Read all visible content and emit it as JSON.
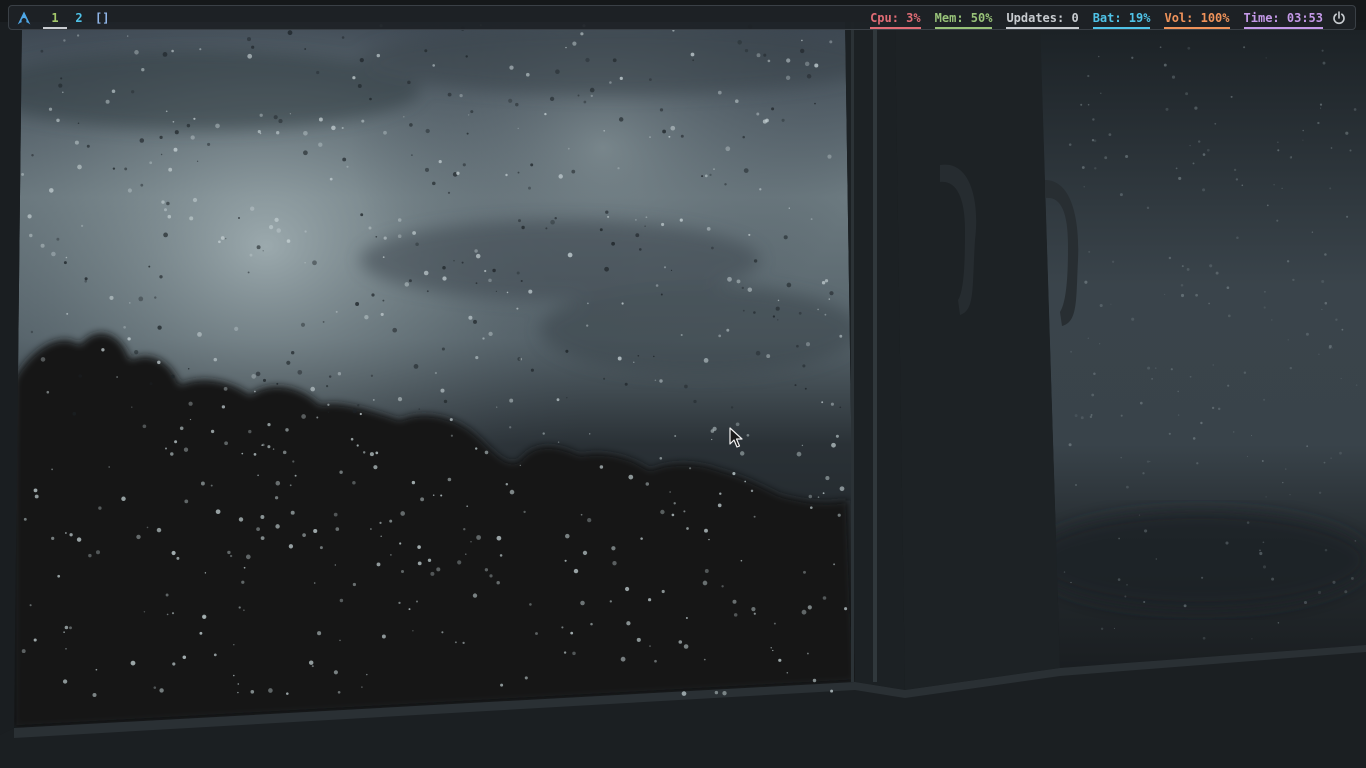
{
  "bar": {
    "logo_icon": "arch-linux-icon",
    "workspaces": [
      {
        "label": "1",
        "active": true,
        "color": "#a4c86a"
      },
      {
        "label": "2",
        "active": false,
        "color": "#4fc3e8"
      }
    ],
    "layout_symbol": "[]",
    "modules": {
      "cpu": {
        "text": "Cpu: 3%",
        "color": "#e06c75"
      },
      "mem": {
        "text": "Mem: 50%",
        "color": "#98c379"
      },
      "updates": {
        "text": "Updates: 0",
        "color": "#c8ccd0"
      },
      "bat": {
        "text": "Bat: 19%",
        "color": "#4fc3e8"
      },
      "vol": {
        "text": "Vol: 100%",
        "color": "#f0935a"
      },
      "time": {
        "text": "Time: 03:53",
        "color": "#c499e8"
      }
    },
    "power_icon": "power-icon"
  },
  "desktop": {
    "wallpaper": "rainy-window-wallpaper",
    "cursor_icon": "mouse-pointer-icon"
  }
}
